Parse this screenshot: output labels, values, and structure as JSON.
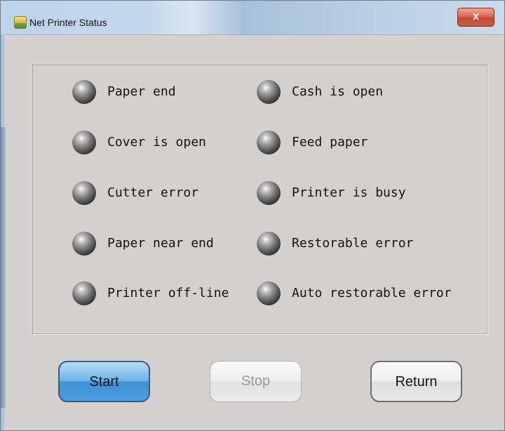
{
  "window": {
    "title": "Net Printer Status",
    "close_label": "x"
  },
  "status": {
    "left_column": [
      {
        "label": "Paper end",
        "state": "off"
      },
      {
        "label": "Cover is open",
        "state": "off"
      },
      {
        "label": "Cutter error",
        "state": "off"
      },
      {
        "label": "Paper near end",
        "state": "off"
      },
      {
        "label": "Printer off-line",
        "state": "off"
      }
    ],
    "right_column": [
      {
        "label": "Cash is open",
        "state": "off"
      },
      {
        "label": "Feed paper",
        "state": "off"
      },
      {
        "label": "Printer is busy",
        "state": "off"
      },
      {
        "label": "Restorable error",
        "state": "off"
      },
      {
        "label": "Auto restorable error",
        "state": "off"
      }
    ]
  },
  "buttons": {
    "start": {
      "label": "Start",
      "enabled": true,
      "focused": true
    },
    "stop": {
      "label": "Stop",
      "enabled": false
    },
    "return": {
      "label": "Return",
      "enabled": true
    }
  },
  "colors": {
    "window_bg": "#d4d0d0",
    "led_off": "#5a5a5a",
    "start_accent": "#4e9ee0",
    "close_red": "#c24a33"
  }
}
